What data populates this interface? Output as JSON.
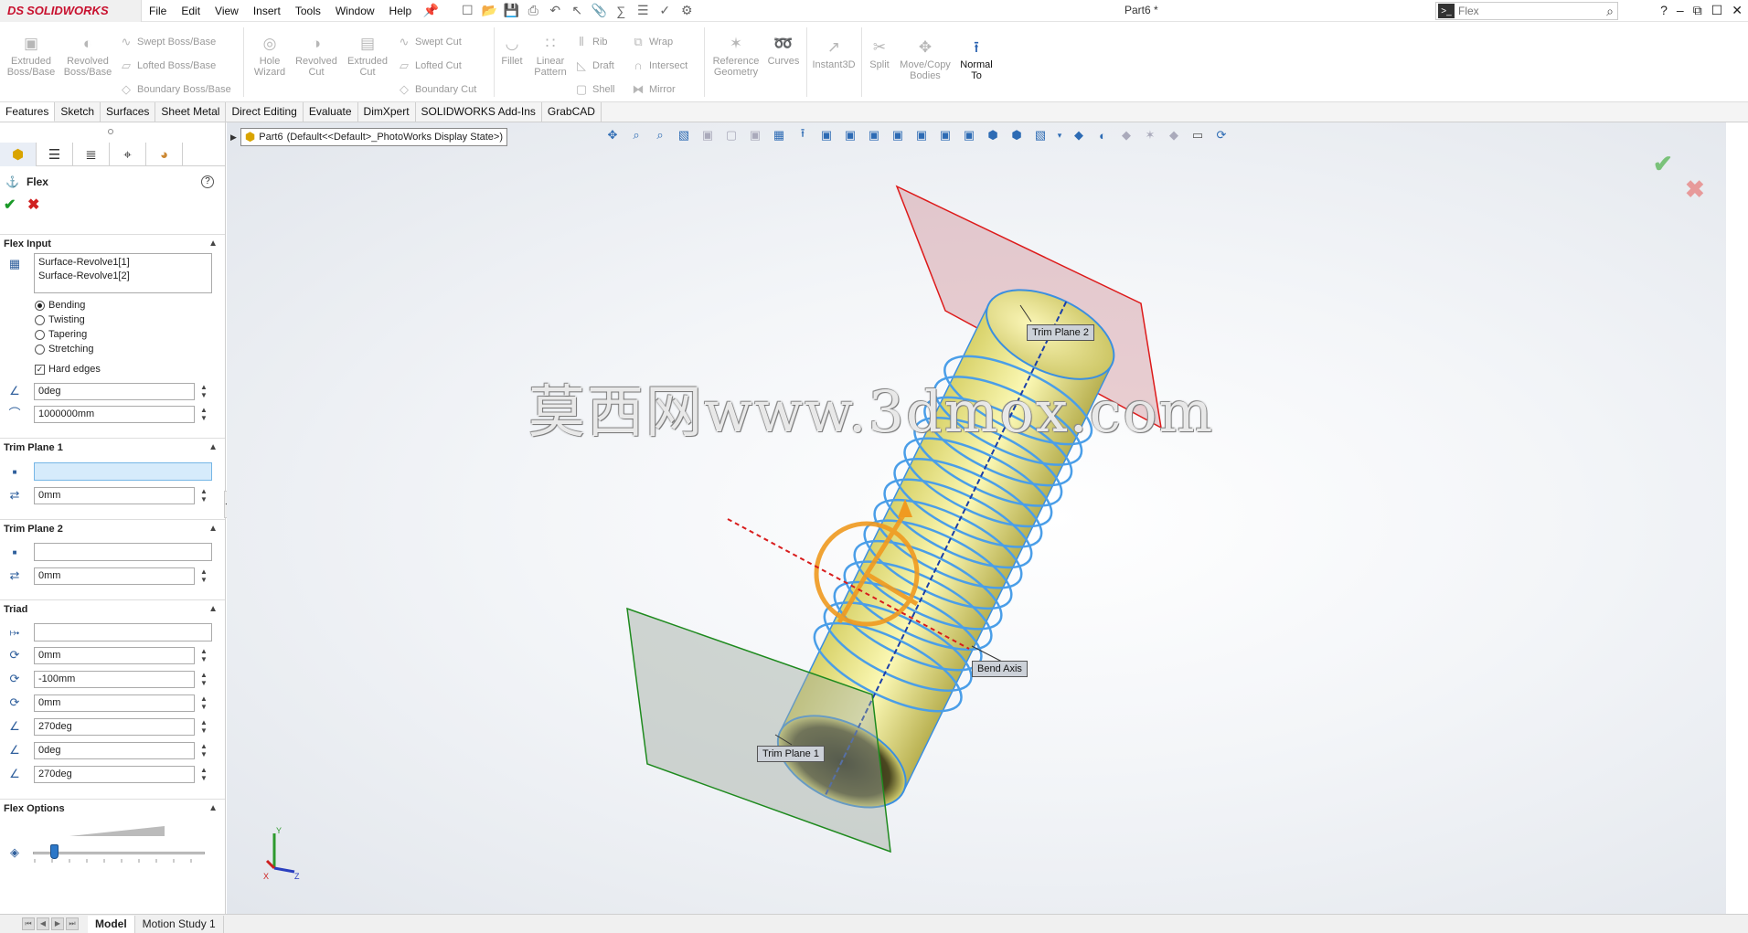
{
  "app": {
    "brand": "SOLIDWORKS",
    "brand_prefix": "DS",
    "doc_title": "Part6 *"
  },
  "menu": [
    "File",
    "Edit",
    "View",
    "Insert",
    "Tools",
    "Window",
    "Help"
  ],
  "search": {
    "placeholder": "Flex"
  },
  "ribbon": {
    "extruded_boss": "Extruded Boss/Base",
    "revolved_boss": "Revolved Boss/Base",
    "swept_boss": "Swept Boss/Base",
    "lofted_boss": "Lofted Boss/Base",
    "boundary_boss": "Boundary Boss/Base",
    "hole_wizard": "Hole Wizard",
    "revolved_cut": "Revolved Cut",
    "extruded_cut": "Extruded Cut",
    "swept_cut": "Swept Cut",
    "lofted_cut": "Lofted Cut",
    "boundary_cut": "Boundary Cut",
    "fillet": "Fillet",
    "linear_pattern": "Linear Pattern",
    "rib": "Rib",
    "draft": "Draft",
    "shell": "Shell",
    "wrap": "Wrap",
    "intersect": "Intersect",
    "mirror": "Mirror",
    "reference_geometry": "Reference Geometry",
    "curves": "Curves",
    "instant3d": "Instant3D",
    "split": "Split",
    "move_copy": "Move/Copy Bodies",
    "normal_to": "Normal To"
  },
  "tabs": [
    "Features",
    "Sketch",
    "Surfaces",
    "Sheet Metal",
    "Direct Editing",
    "Evaluate",
    "DimXpert",
    "SOLIDWORKS Add-Ins",
    "GrabCAD"
  ],
  "property_manager": {
    "title": "Flex",
    "flex_input": {
      "label": "Flex Input",
      "bodies": [
        "Surface-Revolve1[1]",
        "Surface-Revolve1[2]"
      ],
      "modes": [
        "Bending",
        "Twisting",
        "Tapering",
        "Stretching"
      ],
      "selected_mode": "Bending",
      "hard_edges_label": "Hard edges",
      "hard_edges_checked": true,
      "angle": "0deg",
      "radius": "1000000mm"
    },
    "trim_plane_1": {
      "label": "Trim Plane 1",
      "offset": "0mm"
    },
    "trim_plane_2": {
      "label": "Trim Plane 2",
      "offset": "0mm"
    },
    "triad": {
      "label": "Triad",
      "x": "0mm",
      "y": "-100mm",
      "z": "0mm",
      "rx": "270deg",
      "ry": "0deg",
      "rz": "270deg"
    },
    "flex_options": {
      "label": "Flex Options"
    }
  },
  "tree": {
    "part": "Part6",
    "config": "(Default<<Default>_PhotoWorks Display State>)"
  },
  "callouts": {
    "trim_plane_2": "Trim Plane 2",
    "trim_plane_1": "Trim Plane 1",
    "bend_axis": "Bend Axis"
  },
  "watermark": "莫西网www.3dmox.com",
  "axes": {
    "x": "X",
    "y": "Y",
    "z": "Z"
  },
  "bottom_tabs": [
    "Model",
    "Motion Study 1"
  ],
  "colors": {
    "accent": "#2a62b0",
    "ok": "#1a9a28",
    "cancel": "#d02020",
    "body_yellow": "#f3f08a",
    "edge_blue": "#4a9ee8"
  }
}
